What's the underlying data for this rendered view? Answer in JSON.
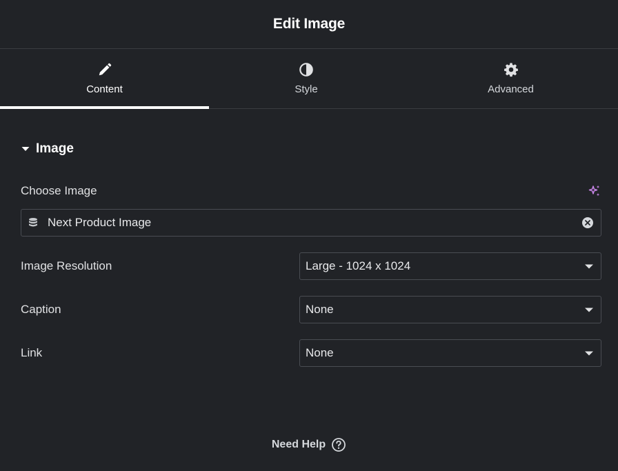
{
  "header": {
    "title": "Edit Image"
  },
  "tabs": [
    {
      "label": "Content",
      "icon": "pencil-icon",
      "active": true
    },
    {
      "label": "Style",
      "icon": "half-circle-icon",
      "active": false
    },
    {
      "label": "Advanced",
      "icon": "gear-icon",
      "active": false
    }
  ],
  "section": {
    "title": "Image",
    "choose_image": {
      "label": "Choose Image",
      "value": "Next Product Image",
      "icons": {
        "ai": "sparkle-icon",
        "source": "database-icon",
        "clear": "clear-icon"
      }
    },
    "controls": [
      {
        "label": "Image Resolution",
        "value": "Large - 1024 x 1024"
      },
      {
        "label": "Caption",
        "value": "None"
      },
      {
        "label": "Link",
        "value": "None"
      }
    ]
  },
  "footer": {
    "help_label": "Need Help"
  },
  "colors": {
    "background": "#212327",
    "accent_ai": "#c985e8",
    "border": "#4a4d53",
    "text": "#e0e1e3"
  }
}
